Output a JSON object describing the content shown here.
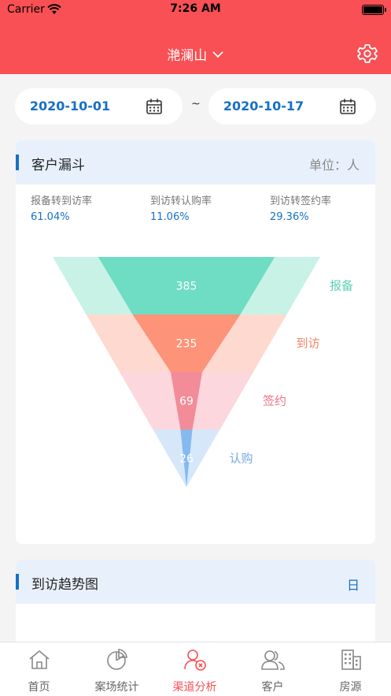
{
  "status_bar": {
    "carrier": "Carrier",
    "time": "7:26 AM"
  },
  "nav": {
    "title": "滟澜山"
  },
  "date_range": {
    "start": "2020-10-01",
    "separator": "~",
    "end": "2020-10-17"
  },
  "funnel_card": {
    "title": "客户漏斗",
    "unit": "单位：人",
    "rates": [
      {
        "label": "报备转到访率",
        "value": "61.04%"
      },
      {
        "label": "到访转认购率",
        "value": "11.06%"
      },
      {
        "label": "到访转签约率",
        "value": "29.36%"
      }
    ]
  },
  "trend_card": {
    "title": "到访趋势图",
    "granularity": "日"
  },
  "chart_data": {
    "type": "funnel",
    "stages": [
      {
        "name": "报备",
        "value": 385,
        "color": "#6fdcc4",
        "light": "#c9f2e7",
        "label_color": "#5ccfb4"
      },
      {
        "name": "到访",
        "value": 235,
        "color": "#fd9379",
        "light": "#fed9cf",
        "label_color": "#f3856a"
      },
      {
        "name": "签约",
        "value": 69,
        "color": "#f28c99",
        "light": "#fcd7dd",
        "label_color": "#ec7486"
      },
      {
        "name": "认购",
        "value": 26,
        "color": "#85b9ef",
        "light": "#d6e7fa",
        "label_color": "#75a9e1"
      }
    ]
  },
  "tab_bar": {
    "tabs": [
      {
        "label": "首页",
        "icon": "home-icon"
      },
      {
        "label": "案场统计",
        "icon": "pie-chart-icon"
      },
      {
        "label": "渠道分析",
        "icon": "channel-analysis-icon"
      },
      {
        "label": "客户",
        "icon": "customers-icon"
      },
      {
        "label": "房源",
        "icon": "building-icon"
      }
    ],
    "active_index": 2
  },
  "colors": {
    "brand": "#f85054",
    "accent": "#1570c6",
    "header_bg": "#e8f1fb"
  }
}
